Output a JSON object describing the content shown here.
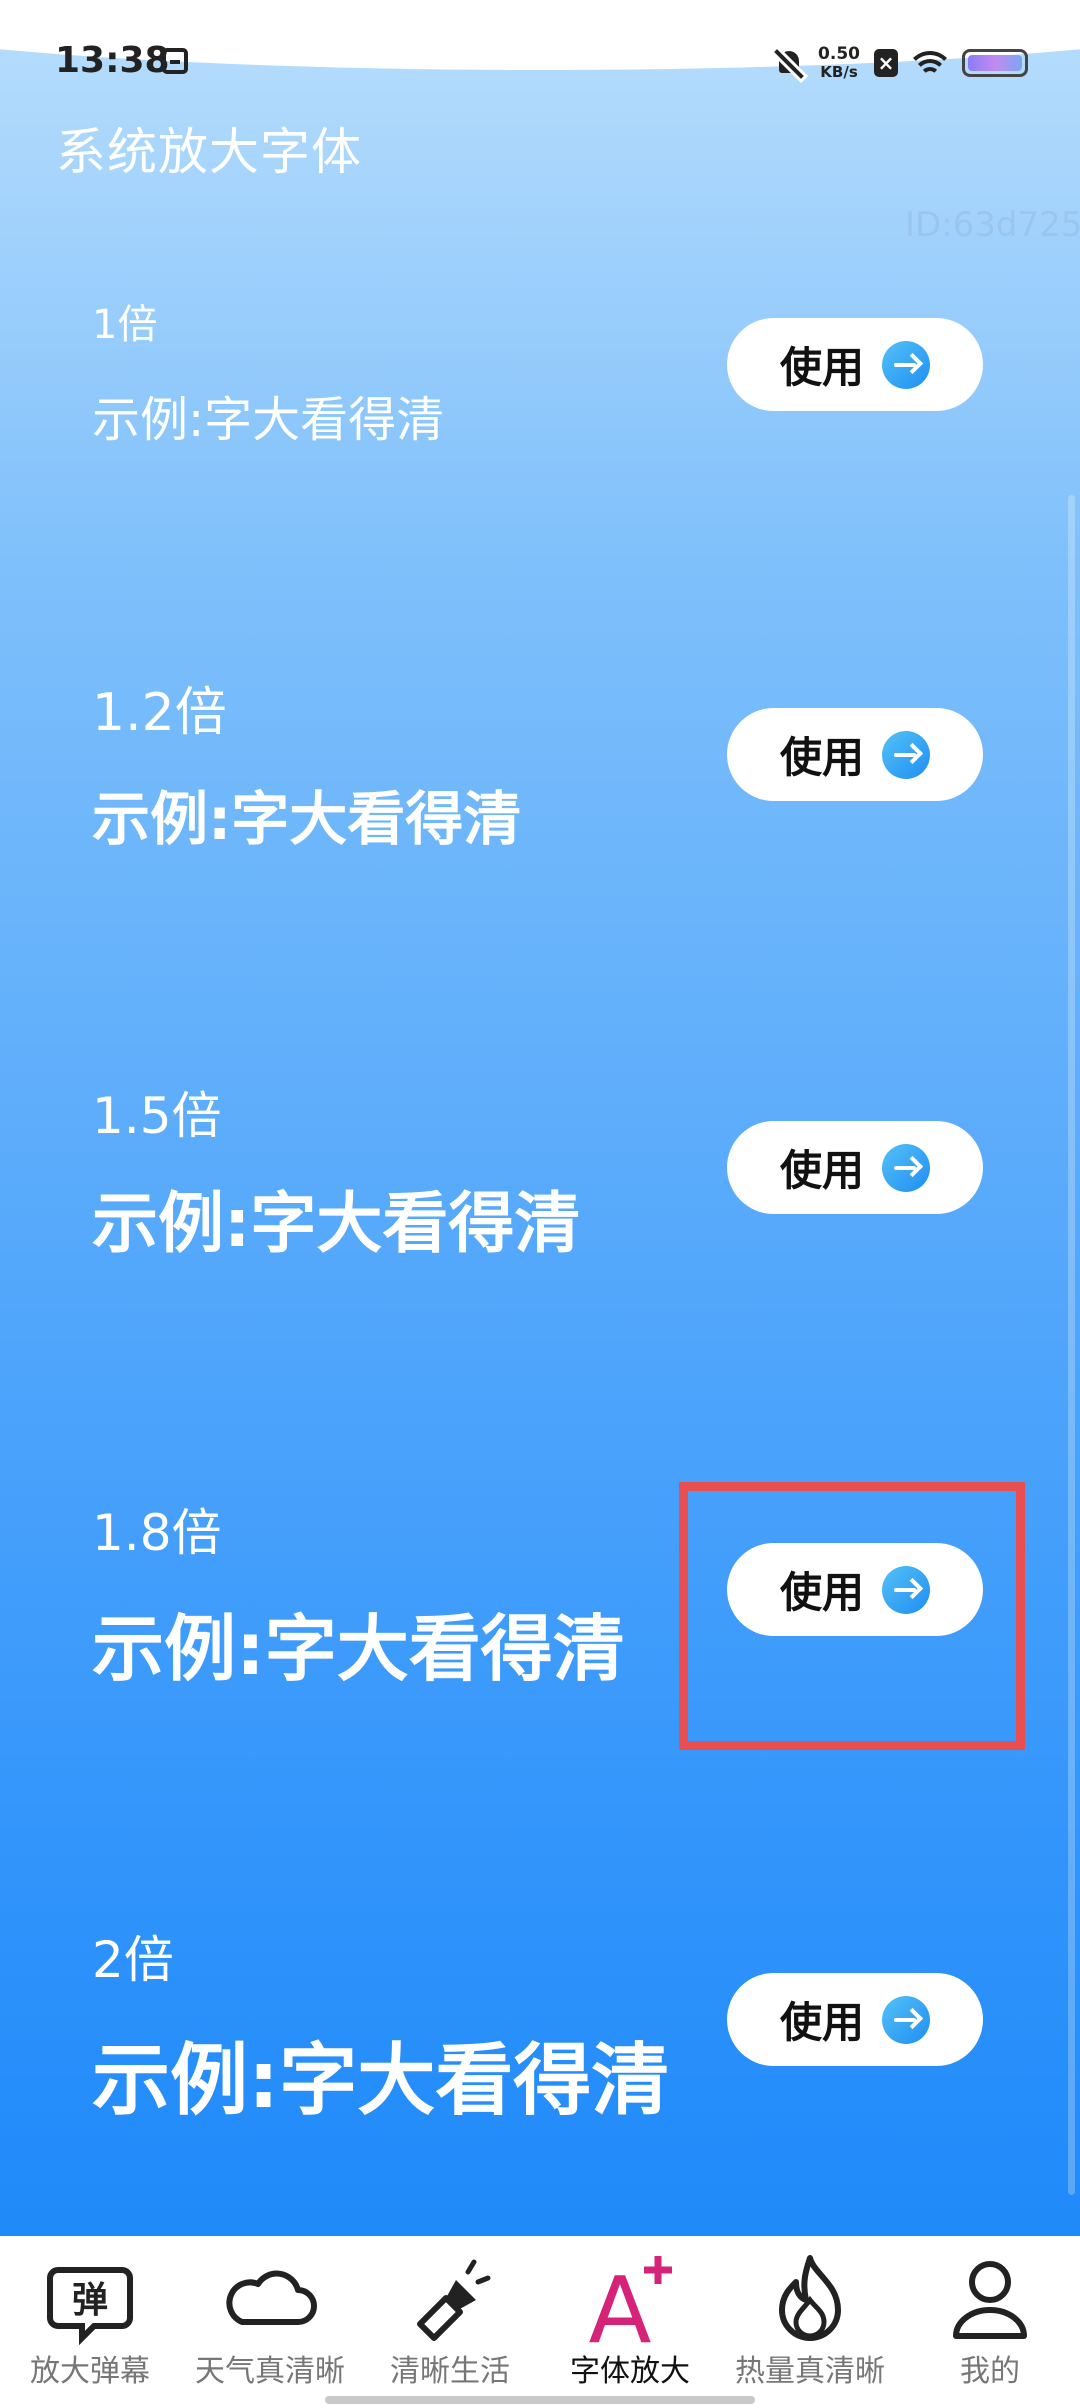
{
  "status_bar": {
    "time": "13:38",
    "net_speed_value": "0.50",
    "net_speed_unit": "KB/s",
    "icons": [
      "calendar-icon",
      "bell-off-icon",
      "close-box-icon",
      "wifi-icon",
      "battery-icon"
    ]
  },
  "header": {
    "title": "系统放大字体",
    "id_label": "ID:63d725"
  },
  "options": [
    {
      "scale": "1倍",
      "sample": "示例:字大看得清",
      "button": "使用"
    },
    {
      "scale": "1.2倍",
      "sample": "示例:字大看得清",
      "button": "使用"
    },
    {
      "scale": "1.5倍",
      "sample": "示例:字大看得清",
      "button": "使用"
    },
    {
      "scale": "1.8倍",
      "sample": "示例:字大看得清",
      "button": "使用"
    },
    {
      "scale": "2倍",
      "sample": "示例:字大看得清",
      "button": "使用"
    }
  ],
  "highlight": {
    "target": "options.3.button",
    "color": "#e94e50"
  },
  "bottom_nav": {
    "items": [
      {
        "label": "放大弹幕",
        "icon": "danmaku-icon",
        "active": false
      },
      {
        "label": "天气真清晰",
        "icon": "cloud-icon",
        "active": false
      },
      {
        "label": "清晰生活",
        "icon": "flashlight-icon",
        "active": false
      },
      {
        "label": "字体放大",
        "icon": "font-enlarge-icon",
        "active": true
      },
      {
        "label": "热量真清晰",
        "icon": "flame-icon",
        "active": false
      },
      {
        "label": "我的",
        "icon": "user-icon",
        "active": false
      }
    ],
    "danmaku_glyph": "弹",
    "font_glyph": "A",
    "active_color": "#d6237a"
  }
}
